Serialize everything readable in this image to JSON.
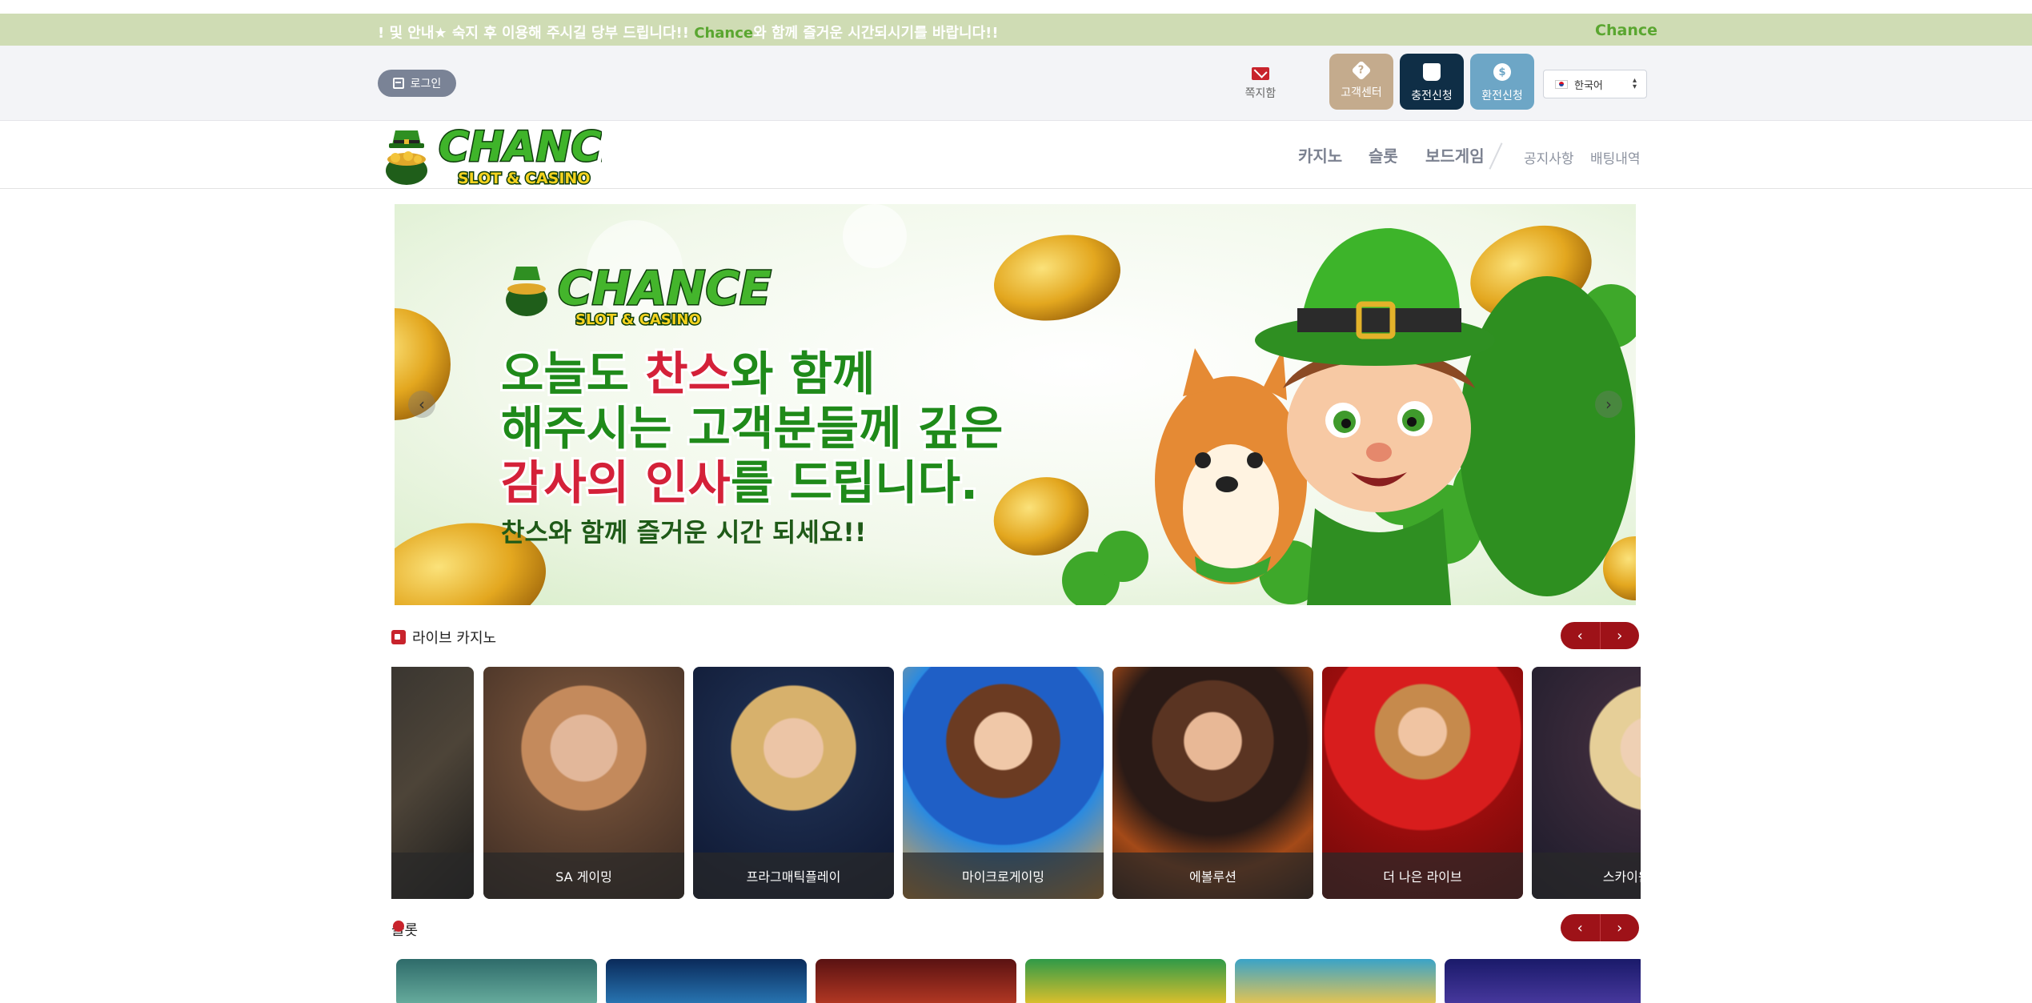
{
  "notice": {
    "prefix": "! 및 안내★ 숙지 후 이용해 주시길 당부 드립니다!! ",
    "brand": "Chance",
    "suffix": "와 함께 즐거운 시간되시기를 바랍니다!!",
    "right_brand": "Chance"
  },
  "header": {
    "login_label": "로그인",
    "message_label": "쪽지함",
    "buttons": [
      {
        "label": "고객센터",
        "icon": "question-diamond-icon"
      },
      {
        "label": "충전신청",
        "icon": "bag-icon"
      },
      {
        "label": "환전신청",
        "icon": "coins-icon"
      }
    ],
    "language": "한국어"
  },
  "logo": {
    "text_top": "CHANCE",
    "text_bottom": "SLOT & CASINO"
  },
  "nav": {
    "main": [
      "카지노",
      "슬롯",
      "보드게임"
    ],
    "sub": [
      "공지사항",
      "배팅내역"
    ]
  },
  "banner": {
    "logo_top": "CHANCE",
    "logo_bottom": "SLOT & CASINO",
    "line1_a": "오늘도 ",
    "line1_b": "찬스",
    "line1_c": "와 함께",
    "line2": "해주시는 고객분들께 깊은",
    "line3_a": "감사의 인사",
    "line3_b": "를 드립니다.",
    "line4": "찬스와 함께 즐거운 시간 되세요!!",
    "prev": "‹",
    "next": "›"
  },
  "live_casino": {
    "title": "라이브 카지노",
    "providers": [
      "",
      "SA 게이밍",
      "프라그매틱플레이",
      "마이크로게이밍",
      "에볼루션",
      "더 나은 라이브",
      "스카이윈드"
    ]
  },
  "slots": {
    "title": "슬롯"
  },
  "pager": {
    "prev": "‹",
    "next": "›"
  },
  "colors": {
    "notice_bg": "#cfdcb4",
    "brand_green": "#5aa630",
    "pager_red": "#9e1218",
    "cs_button": "#c4ab8d",
    "charge_button": "#0f2e46",
    "exchange_button": "#6da6c6"
  }
}
